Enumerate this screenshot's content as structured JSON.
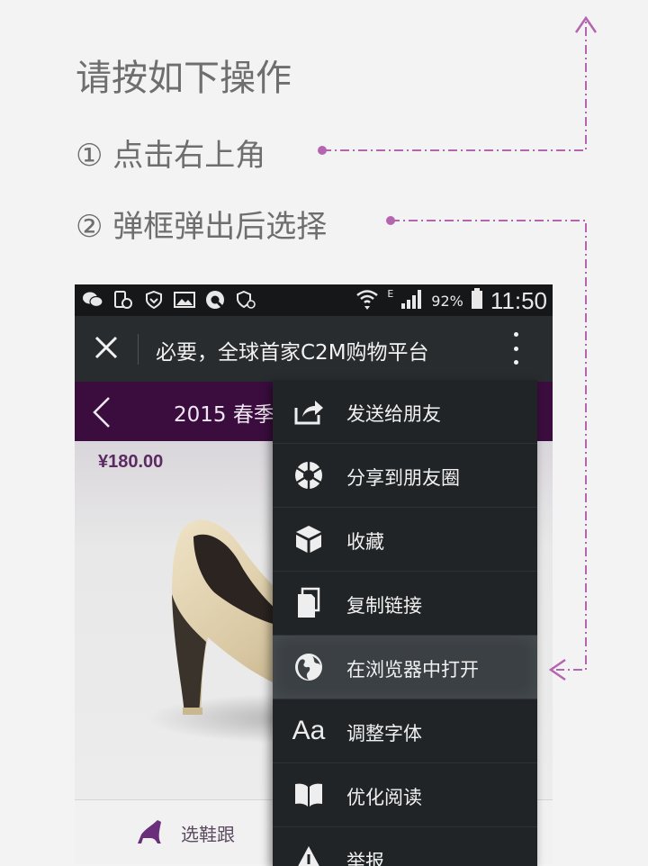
{
  "instructions": {
    "heading": "请按如下操作",
    "step1": "① 点击右上角",
    "step2": "② 弹框弹出后选择"
  },
  "statusbar": {
    "battery_pct": "92%",
    "network_type": "E",
    "time": "11:50",
    "icons": [
      "wechat-icon",
      "phone-status-icon",
      "vpn-shield-icon",
      "gallery-icon",
      "app-q-icon",
      "security-icon",
      "wifi-icon",
      "signal-icon",
      "battery-icon"
    ]
  },
  "appbar": {
    "title": "必要，全球首家C2M购物平台"
  },
  "page": {
    "title": "2015 春季",
    "price": "¥180.00",
    "bottom_action": "选鞋跟"
  },
  "menu": {
    "items": [
      {
        "label": "发送给朋友",
        "icon": "share-to-friend-icon"
      },
      {
        "label": "分享到朋友圈",
        "icon": "moments-icon"
      },
      {
        "label": "收藏",
        "icon": "favorite-box-icon"
      },
      {
        "label": "复制链接",
        "icon": "copy-link-icon"
      },
      {
        "label": "在浏览器中打开",
        "icon": "globe-icon"
      },
      {
        "label": "调整字体",
        "icon": "font-size-icon"
      },
      {
        "label": "优化阅读",
        "icon": "book-icon"
      },
      {
        "label": "举报",
        "icon": "warning-icon"
      }
    ],
    "highlighted_index": 4,
    "font_icon_text": "Aa"
  },
  "colors": {
    "annotation": "#b565b0",
    "page_header": "#3a0d3e",
    "menu_bg": "#212427"
  }
}
